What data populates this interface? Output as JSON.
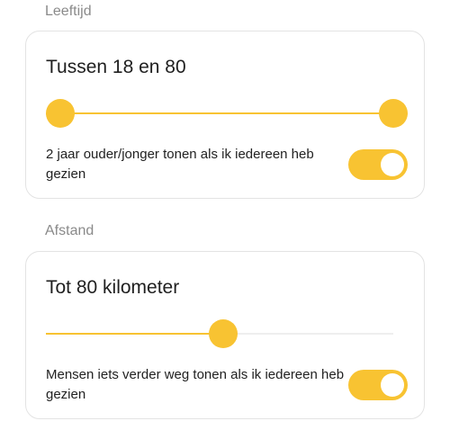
{
  "age": {
    "section_label": "Leeftijd",
    "title": "Tussen 18 en 80",
    "slider": {
      "min": 18,
      "max": 80,
      "low_value": 18,
      "high_value": 80
    },
    "toggle": {
      "label": "2 jaar ouder/jonger tonen als ik iedereen heb gezien",
      "on": true
    }
  },
  "distance": {
    "section_label": "Afstand",
    "title": "Tot 80 kilometer",
    "slider": {
      "value_fraction": 0.49
    },
    "toggle": {
      "label": "Mensen iets verder weg tonen als ik iedereen heb gezien",
      "on": true
    }
  },
  "colors": {
    "accent": "#f8c332",
    "track": "#eeeeee",
    "card_border": "#e3e3e3",
    "section_label": "#8a8a8a"
  }
}
